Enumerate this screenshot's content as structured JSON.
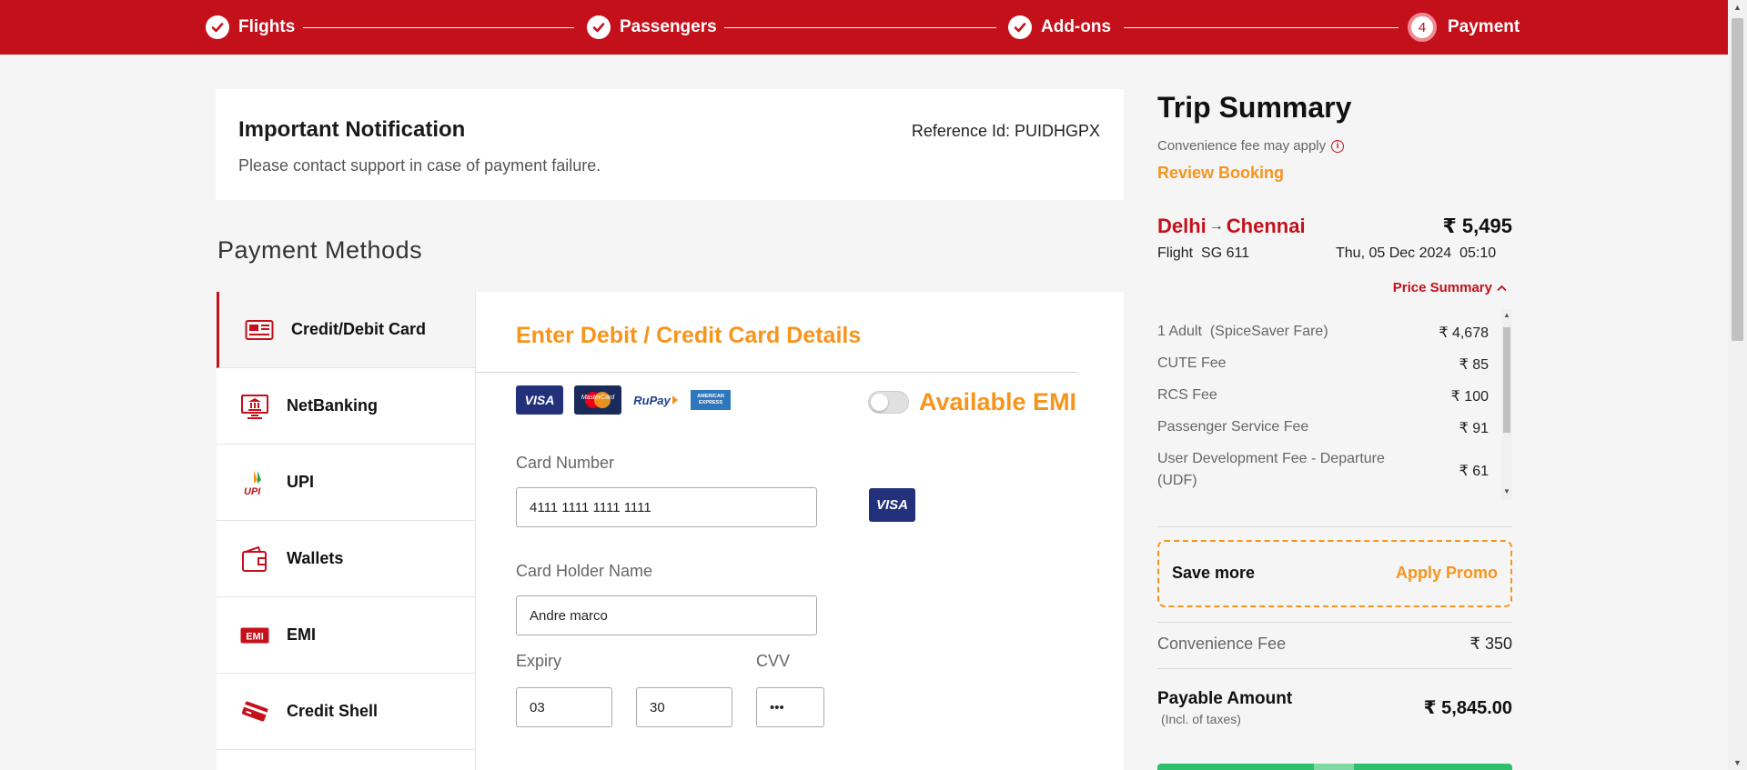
{
  "stepper": {
    "steps": [
      {
        "label": "Flights",
        "state": "done"
      },
      {
        "label": "Passengers",
        "state": "done"
      },
      {
        "label": "Add-ons",
        "state": "done"
      },
      {
        "label": "Payment",
        "state": "current",
        "number": "4"
      }
    ],
    "bar_color": "#c4101b"
  },
  "notification": {
    "title": "Important Notification",
    "reference": "Reference Id: PUIDHGPX",
    "message": "Please contact support in case of payment failure."
  },
  "payment_methods": {
    "heading": "Payment Methods",
    "items": [
      {
        "label": "Credit/Debit Card",
        "icon": "credit-card-icon",
        "active": true
      },
      {
        "label": "NetBanking",
        "icon": "bank-icon",
        "active": false
      },
      {
        "label": "UPI",
        "icon": "upi-logo-icon",
        "active": false
      },
      {
        "label": "Wallets",
        "icon": "wallet-icon",
        "active": false
      },
      {
        "label": "EMI",
        "icon": "emi-icon",
        "active": false
      },
      {
        "label": "Credit Shell",
        "icon": "credit-shell-icon",
        "active": false
      }
    ]
  },
  "card_form": {
    "title": "Enter Debit / Credit Card Details",
    "card_logos": [
      "VISA",
      "MasterCard",
      "RuPay",
      "AMERICAN EXPRESS"
    ],
    "emi_label": "Available EMI",
    "emi_enabled": false,
    "card_number_label": "Card Number",
    "card_number_value": "4111 1111 1111 1111",
    "detected_brand": "VISA",
    "holder_label": "Card Holder Name",
    "holder_value": "Andre marco",
    "expiry_label": "Expiry",
    "expiry_month": "03",
    "expiry_year": "30",
    "cvv_label": "CVV",
    "cvv_value": "•••"
  },
  "trip_summary": {
    "title": "Trip Summary",
    "convenience_note": "Convenience fee may apply",
    "review_link": "Review Booking",
    "origin": "Delhi",
    "destination": "Chennai",
    "route_price": "₹ 5,495",
    "flight": "Flight  SG 611",
    "date": "Thu, 05 Dec 2024  05:10",
    "price_summary_label": "Price Summary",
    "fees": [
      {
        "label": "1 Adult  (SpiceSaver Fare)",
        "value": "₹ 4,678"
      },
      {
        "label": "CUTE Fee",
        "value": "₹ 85"
      },
      {
        "label": "RCS Fee",
        "value": "₹ 100"
      },
      {
        "label": "Passenger Service Fee",
        "value": "₹ 91"
      },
      {
        "label": "User Development Fee - Departure",
        "label2": "(UDF)",
        "value": "₹ 61"
      }
    ],
    "promo_left": "Save more",
    "promo_right": "Apply Promo",
    "convenience_fee_label": "Convenience Fee",
    "convenience_fee_value": "₹ 350",
    "payable_label": "Payable Amount",
    "payable_sub": "(Incl. of taxes)",
    "payable_value": "₹ 5,845.00"
  },
  "colors": {
    "brand_red": "#c4101b",
    "accent_orange": "#f7941d",
    "pay_green": "#2dbf6c"
  }
}
